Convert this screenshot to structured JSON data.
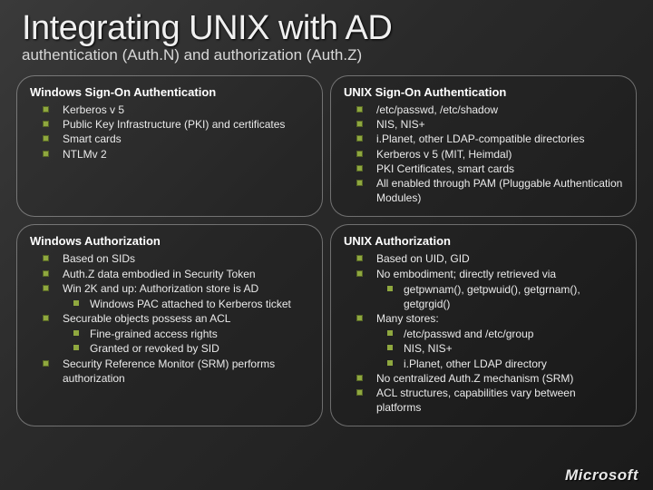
{
  "header": {
    "title": "Integrating UNIX with AD",
    "subtitle": "authentication (Auth.N) and authorization (Auth.Z)"
  },
  "footer": {
    "logo_text": "Microsoft"
  },
  "panels": {
    "win_authn": {
      "title": "Windows Sign-On Authentication",
      "items": [
        "Kerberos v 5",
        "Public Key Infrastructure (PKI) and certificates",
        "Smart cards",
        "NTLMv 2"
      ]
    },
    "unix_authn": {
      "title": "UNIX Sign-On Authentication",
      "items": [
        "/etc/passwd, /etc/shadow",
        "NIS, NIS+",
        "i.Planet, other LDAP-compatible directories",
        "Kerberos v 5 (MIT, Heimdal)",
        "PKI Certificates, smart cards",
        "All enabled through PAM (Pluggable Authentication Modules)"
      ]
    },
    "win_authz": {
      "title": "Windows Authorization",
      "items": [
        {
          "text": "Based on SIDs"
        },
        {
          "text": "Auth.Z data embodied in Security Token"
        },
        {
          "text": "Win 2K and up: Authorization store is AD",
          "sub": [
            "Windows PAC attached to Kerberos ticket"
          ]
        },
        {
          "text": "Securable objects possess an ACL",
          "sub": [
            "Fine-grained access rights",
            "Granted or revoked by SID"
          ]
        },
        {
          "text": "Security Reference Monitor (SRM) performs authorization"
        }
      ]
    },
    "unix_authz": {
      "title": "UNIX Authorization",
      "items": [
        {
          "text": "Based on UID, GID"
        },
        {
          "text": "No embodiment; directly retrieved via",
          "sub": [
            "getpwnam(), getpwuid(), getgrnam(), getgrgid()"
          ]
        },
        {
          "text": "Many stores:",
          "sub": [
            "/etc/passwd and /etc/group",
            "NIS, NIS+",
            "i.Planet, other LDAP directory"
          ]
        },
        {
          "text": "No centralized Auth.Z mechanism (SRM)"
        },
        {
          "text": "ACL structures, capabilities vary between platforms"
        }
      ]
    }
  }
}
